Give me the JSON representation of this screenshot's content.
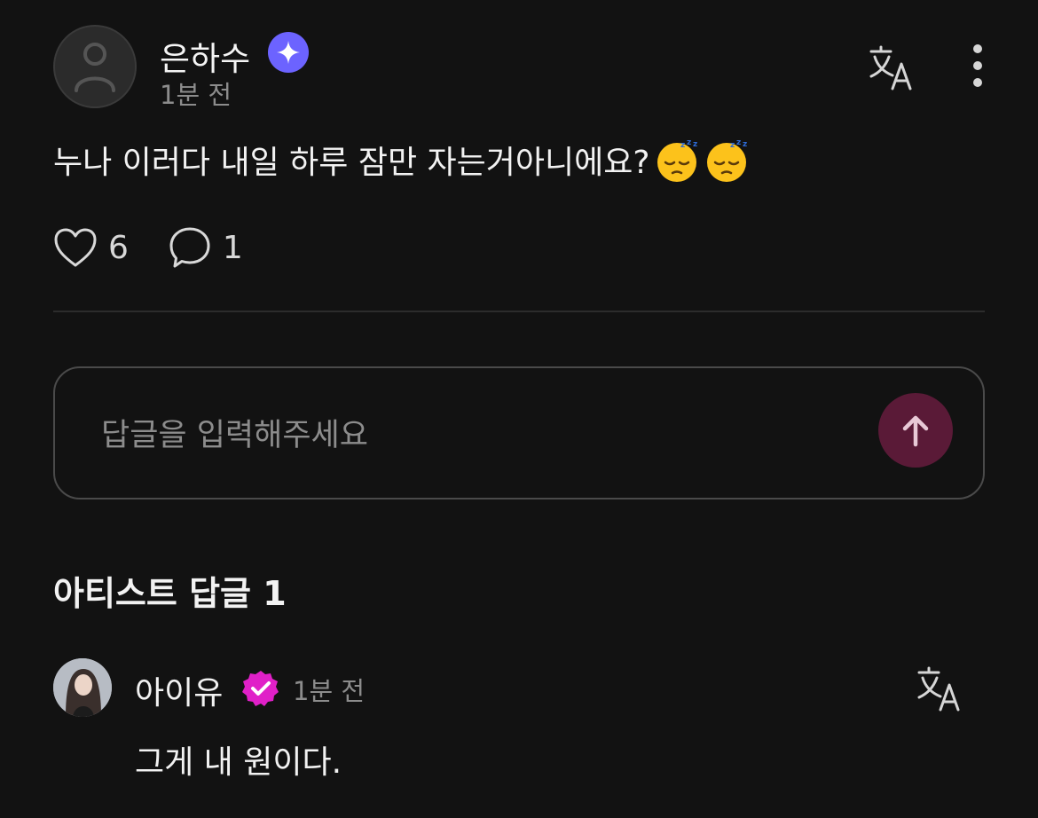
{
  "post": {
    "author": "은하수",
    "time": "1분 전",
    "body": "누나 이러다 내일 하루 잠만 자는거아니에요?",
    "emojis": [
      "sleeping-face",
      "sleeping-face"
    ],
    "likes": "6",
    "comments": "1",
    "badge_icon": "sparkle-badge-icon"
  },
  "reply": {
    "placeholder": "답글을 입력해주세요"
  },
  "section": {
    "title": "아티스트 답글 1"
  },
  "artist_reply": {
    "author": "아이유",
    "time": "1분 전",
    "text": "그게 내 원이다.",
    "badge_icon": "verified-badge-icon"
  },
  "colors": {
    "background": "#121212",
    "star_badge": "#6c63ff",
    "verified_badge": "#e020c8",
    "send_button": "#5a1a37"
  }
}
